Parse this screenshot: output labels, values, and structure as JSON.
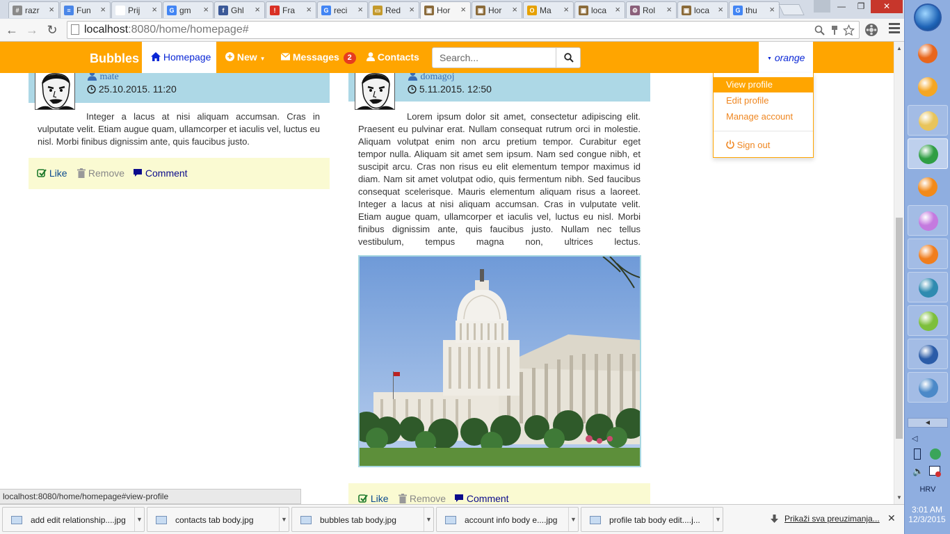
{
  "browser": {
    "tabs": [
      {
        "title": "razr",
        "fav": "#",
        "color": "#8a8a8a"
      },
      {
        "title": "Fun",
        "fav": "≡",
        "color": "#4a86e8"
      },
      {
        "title": "Prij",
        "fav": "",
        "color": "#ffffff"
      },
      {
        "title": "gm",
        "fav": "G",
        "color": "#4285f4"
      },
      {
        "title": "Ghl",
        "fav": "f",
        "color": "#3b5998"
      },
      {
        "title": "Fra",
        "fav": "!",
        "color": "#d93025"
      },
      {
        "title": "reci",
        "fav": "G",
        "color": "#4285f4"
      },
      {
        "title": "Red",
        "fav": "▭",
        "color": "#c49a2c"
      },
      {
        "title": "Hor",
        "fav": "▣",
        "color": "#8b6b3a"
      },
      {
        "title": "Hor",
        "fav": "▣",
        "color": "#8b6b3a"
      },
      {
        "title": "Ma",
        "fav": "O",
        "color": "#e6a100"
      },
      {
        "title": "loca",
        "fav": "▣",
        "color": "#8b6b3a"
      },
      {
        "title": "Rol",
        "fav": "⚙",
        "color": "#8a5f7a"
      },
      {
        "title": "loca",
        "fav": "▣",
        "color": "#8b6b3a"
      },
      {
        "title": "thu",
        "fav": "G",
        "color": "#4285f4"
      }
    ],
    "active_tab_index": 8,
    "url_host": "localhost",
    "url_rest": ":8080/home/homepage#",
    "window_controls": {
      "minimize": "—",
      "maximize": "❐",
      "close": "✕"
    },
    "status_url": "localhost:8080/home/homepage#view-profile"
  },
  "app": {
    "brand": "Bubbles",
    "accent_color": "#ffa500",
    "nav": {
      "homepage": "Homepage",
      "new": "New",
      "messages": "Messages",
      "messages_badge": "2",
      "contacts": "Contacts"
    },
    "search": {
      "placeholder": "Search..."
    },
    "user": "orange",
    "dropdown": {
      "view_profile": "View profile",
      "edit_profile": "Edit profile",
      "manage_account": "Manage account",
      "sign_out": "Sign out"
    }
  },
  "posts": [
    {
      "author": "mate",
      "date": "25.10.2015. 11:20",
      "text": "Integer a lacus at nisi aliquam accumsan. Cras in vulputate velit. Etiam augue quam, ullamcorper et iaculis vel, luctus eu nisl. Morbi finibus dignissim ante, quis faucibus justo.",
      "actions": {
        "like": "Like",
        "remove": "Remove",
        "comment": "Comment"
      }
    },
    {
      "author": "domagoj",
      "date": "5.11.2015. 12:50",
      "text": "Lorem ipsum dolor sit amet, consectetur adipiscing elit. Praesent eu pulvinar erat. Nullam consequat rutrum orci in molestie. Aliquam volutpat enim non arcu pretium tempor. Curabitur eget tempor nulla. Aliquam sit amet sem ipsum. Nam sed congue nibh, et suscipit arcu. Cras non risus eu elit elementum tempor maximus id diam. Nam sit amet volutpat odio, quis fermentum nibh. Sed faucibus consequat scelerisque. Mauris elementum aliquam risus a laoreet. Integer a lacus at nisi aliquam accumsan. Cras in vulputate velit. Etiam augue quam, ullamcorper et iaculis vel, luctus eu nisl. Morbi finibus dignissim ante, quis faucibus justo. Nullam nec tellus vestibulum, tempus magna non, ultrices lectus.",
      "image": "capitol-building-photo",
      "actions": {
        "like": "Like",
        "remove": "Remove",
        "comment": "Comment"
      }
    }
  ],
  "downloads": {
    "items": [
      "add edit relationship....jpg",
      "contacts tab body.jpg",
      "bubbles tab body.jpg",
      "account info body e....jpg",
      "profile tab  body edit....j..."
    ],
    "show_all": "Prikaži sva preuzimanja...",
    "close": "✕"
  },
  "taskbar": {
    "apps": [
      {
        "name": "firefox-icon",
        "color": "#e8661c",
        "state": "plain"
      },
      {
        "name": "chrome-canary-icon",
        "color": "#f5a623",
        "state": "plain"
      },
      {
        "name": "file-explorer-icon",
        "color": "#e8c45a",
        "state": "pinned"
      },
      {
        "name": "chrome-icon",
        "color": "#2f9e44",
        "state": "active"
      },
      {
        "name": "vlc-icon",
        "color": "#f28a1a",
        "state": "plain"
      },
      {
        "name": "itunes-icon",
        "color": "#c47adf",
        "state": "pinned"
      },
      {
        "name": "media-player-icon",
        "color": "#f07e1e",
        "state": "pinned"
      },
      {
        "name": "network-tool-icon",
        "color": "#2f8bb0",
        "state": "pinned"
      },
      {
        "name": "notepad-plus-plus-icon",
        "color": "#7dbf3c",
        "state": "pinned"
      },
      {
        "name": "brackets-icon",
        "color": "#2b5ca8",
        "state": "pinned"
      },
      {
        "name": "mysql-installer-icon",
        "color": "#4b89c8",
        "state": "pinned"
      }
    ],
    "language": "HRV",
    "time": "3:01 AM",
    "date": "12/3/2015"
  }
}
